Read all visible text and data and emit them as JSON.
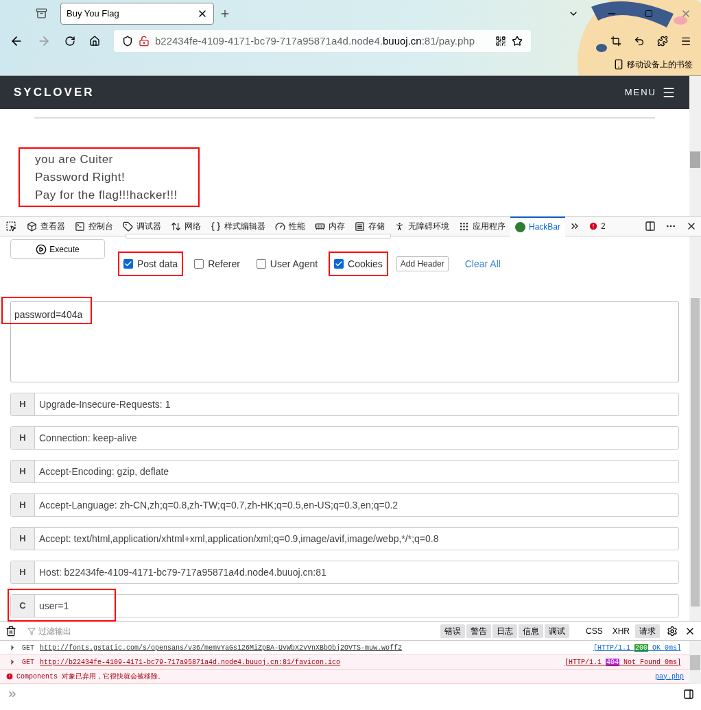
{
  "browser": {
    "tab": {
      "title": "Buy You Flag"
    },
    "url": {
      "host_prefix": "b22434fe-4109-4171-bc79-717a95871a4d.node4.",
      "host_main": "buuoj.cn",
      "rest": ":81/pay.php"
    },
    "bookmarks_label": "移动设备上的书签"
  },
  "site": {
    "brand": "SYCLOVER",
    "menu": "MENU",
    "messages": [
      "you are Cuiter",
      "Password Right!",
      "Pay for the flag!!!hacker!!!"
    ],
    "highlighted": true
  },
  "devtools": {
    "tabs": [
      {
        "label": "查看器",
        "selected": false
      },
      {
        "label": "控制台",
        "selected": false
      },
      {
        "label": "调试器",
        "selected": false
      },
      {
        "label": "网络",
        "selected": false
      },
      {
        "label": "样式编辑器",
        "selected": false
      },
      {
        "label": "性能",
        "selected": false
      },
      {
        "label": "内存",
        "selected": false
      },
      {
        "label": "存储",
        "selected": false
      },
      {
        "label": "无障碍环境",
        "selected": false
      },
      {
        "label": "应用程序",
        "selected": false
      },
      {
        "label": "HackBar",
        "selected": true
      }
    ],
    "error_count": "2"
  },
  "hackbar": {
    "execute": "Execute",
    "options": [
      {
        "label": "Post data",
        "checked": true,
        "highlighted": true
      },
      {
        "label": "Referer",
        "checked": false,
        "highlighted": false
      },
      {
        "label": "User Agent",
        "checked": false,
        "highlighted": false
      },
      {
        "label": "Cookies",
        "checked": true,
        "highlighted": true
      }
    ],
    "add_header": "Add Header",
    "clear_all": "Clear All",
    "post_body": {
      "value": "password=404a",
      "highlighted": true
    },
    "headers": [
      {
        "type": "H",
        "value": "Upgrade-Insecure-Requests: 1",
        "highlighted": false
      },
      {
        "type": "H",
        "value": "Connection: keep-alive",
        "highlighted": false
      },
      {
        "type": "H",
        "value": "Accept-Encoding: gzip, deflate",
        "highlighted": false
      },
      {
        "type": "H",
        "value": "Accept-Language: zh-CN,zh;q=0.8,zh-TW;q=0.7,zh-HK;q=0.5,en-US;q=0.3,en;q=0.2",
        "highlighted": false
      },
      {
        "type": "H",
        "value": "Accept: text/html,application/xhtml+xml,application/xml;q=0.9,image/avif,image/webp,*/*;q=0.8",
        "highlighted": false
      },
      {
        "type": "H",
        "value": "Host: b22434fe-4109-4171-bc79-717a95871a4d.node4.buuoj.cn:81",
        "highlighted": false
      },
      {
        "type": "C",
        "value": "user=1",
        "highlighted": true
      }
    ]
  },
  "console": {
    "filter_placeholder": "过滤输出",
    "levels": [
      {
        "label": "错误",
        "selected": true
      },
      {
        "label": "警告",
        "selected": true
      },
      {
        "label": "日志",
        "selected": true
      },
      {
        "label": "信息",
        "selected": true
      },
      {
        "label": "调试",
        "selected": true
      }
    ],
    "types": [
      {
        "label": "CSS",
        "selected": false
      },
      {
        "label": "XHR",
        "selected": false
      },
      {
        "label": "请求",
        "selected": true
      }
    ],
    "entries": [
      {
        "kind": "request",
        "method": "GET",
        "url": "http://fonts.gstatic.com/s/opensans/v36/memvYaGs126MiZpBA-UvWbX2vVnXBbObj2OVTS-muw.woff2",
        "protocol": "[HTTP/1.1",
        "status": "200",
        "status_text": "OK 0ms]",
        "error": false
      },
      {
        "kind": "request",
        "method": "GET",
        "url": "http://b22434fe-4109-4171-bc79-717a95871a4d.node4.buuoj.cn:81/favicon.ico",
        "protocol": "[HTTP/1.1",
        "status": "404",
        "status_text": "Not Found 0ms]",
        "error": true
      },
      {
        "kind": "error",
        "message": "Components 对象已弃用，它很快就会被移除。",
        "source": "pay.php"
      }
    ]
  }
}
